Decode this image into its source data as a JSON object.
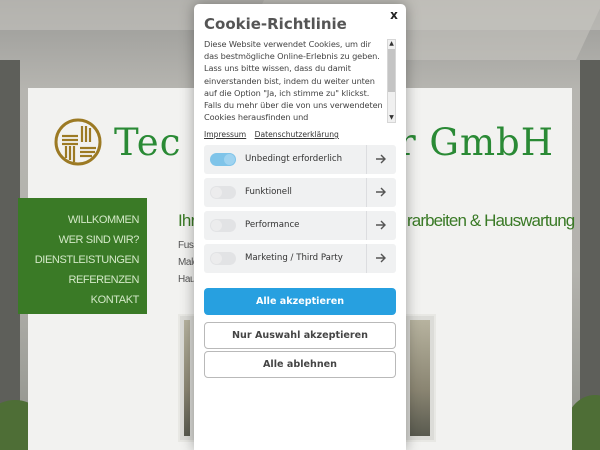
{
  "website": {
    "brand_left": "Tec",
    "brand_right": "r GmbH",
    "nav": [
      "Willkommen",
      "Wer sind wir?",
      "Dienstleistungen",
      "Referenzen",
      "Kontakt"
    ],
    "heading_left": "Ihr",
    "heading_right": "rarbeiten & Hauswartung",
    "side_lines": [
      "Fuss",
      "Male",
      "Haus"
    ]
  },
  "cookie": {
    "title": "Cookie-Richtlinie",
    "close": "x",
    "text": "Diese Website verwendet Cookies, um dir das bestmögliche Online-Erlebnis zu geben. Lass uns bitte wissen, dass du damit einverstanden bist, indem du weiter unten auf die Option \"Ja, ich stimme zu\" klickst. Falls du mehr über die von uns verwendeten Cookies herausfinden und",
    "links": {
      "impressum": "Impressum",
      "datenschutz": "Datenschutzerklärung"
    },
    "options": [
      {
        "label": "Unbedingt erforderlich",
        "enabled": true
      },
      {
        "label": "Funktionell",
        "enabled": false
      },
      {
        "label": "Performance",
        "enabled": false
      },
      {
        "label": "Marketing / Third Party",
        "enabled": false
      }
    ],
    "buttons": {
      "accept_all": "Alle akzeptieren",
      "accept_selection": "Nur Auswahl akzeptieren",
      "reject_all": "Alle ablehnen"
    }
  },
  "colors": {
    "brand_green": "#2a8a35",
    "nav_green": "#3a7a26",
    "primary_blue": "#27a0e0",
    "toggle_on": "#7fc4e9"
  }
}
